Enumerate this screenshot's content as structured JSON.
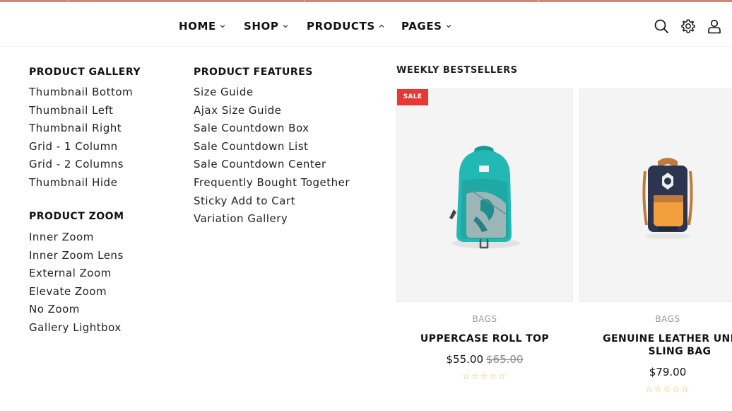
{
  "nav": {
    "items": [
      {
        "label": "HOME",
        "chevron": "down"
      },
      {
        "label": "SHOP",
        "chevron": "down"
      },
      {
        "label": "PRODUCTS",
        "chevron": "up"
      },
      {
        "label": "PAGES",
        "chevron": "down"
      }
    ]
  },
  "header_icons": [
    "search-icon",
    "gear-icon",
    "user-icon"
  ],
  "mega_menu": {
    "product_gallery": {
      "title": "PRODUCT GALLERY",
      "items": [
        "Thumbnail Bottom",
        "Thumbnail Left",
        "Thumbnail Right",
        "Grid - 1 Column",
        "Grid - 2 Columns",
        "Thumbnail Hide"
      ]
    },
    "product_zoom": {
      "title": "PRODUCT ZOOM",
      "items": [
        "Inner Zoom",
        "Inner Zoom Lens",
        "External Zoom",
        "Elevate Zoom",
        "No Zoom",
        "Gallery Lightbox"
      ]
    },
    "product_features": {
      "title": "PRODUCT FEATURES",
      "items": [
        "Size Guide",
        "Ajax Size Guide",
        "Sale Countdown Box",
        "Sale Countdown List",
        "Sale Countdown Center",
        "Frequently Bought Together",
        "Sticky Add to Cart",
        "Variation Gallery"
      ]
    },
    "bestsellers": {
      "title": "WEEKLY BESTSELLERS",
      "products": [
        {
          "badge": "SALE",
          "category": "BAGS",
          "name": "UPPERCASE ROLL TOP",
          "price": "$55.00",
          "old_price": "$65.00",
          "rating": "☆☆☆☆☆"
        },
        {
          "badge": "",
          "category": "BAGS",
          "name": "GENUINE LEATHER UNISEX SLING BAG",
          "price": "$79.00",
          "old_price": "",
          "rating": "☆☆☆☆☆"
        }
      ]
    }
  },
  "colors": {
    "top_strip": "#c98a78",
    "sale_badge": "#e53935",
    "star": "#e8b93a",
    "teal_bag": "#22b8b4",
    "navy_bag": "#2b3550",
    "orange_pocket": "#f2a03d"
  }
}
